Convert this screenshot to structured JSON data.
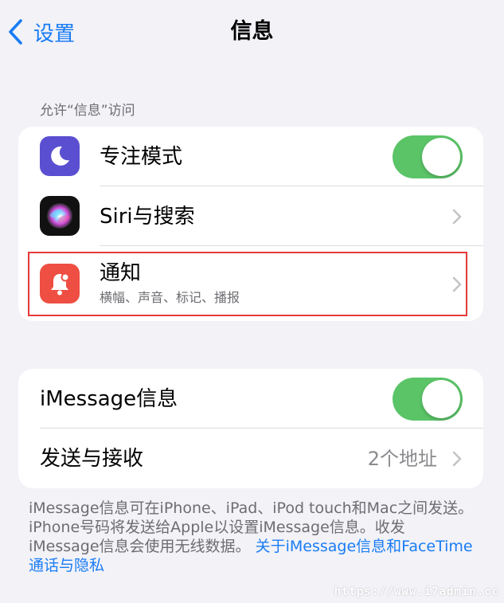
{
  "nav": {
    "back_label": "设置",
    "title": "信息"
  },
  "section": {
    "header": "允许“信息”访问"
  },
  "rows": {
    "focus": {
      "label": "专注模式",
      "icon": "moon-icon",
      "icon_color": "#5b4fd1",
      "toggle_on": true
    },
    "siri": {
      "label": "Siri与搜索",
      "icon": "siri-icon"
    },
    "notifications": {
      "label": "通知",
      "subtitle": "横幅、声音、标记、播报",
      "icon": "bell-icon",
      "icon_color": "#ef4e42"
    },
    "imessage": {
      "label": "iMessage信息",
      "toggle_on": true
    },
    "send_receive": {
      "label": "发送与接收",
      "value": "2个地址"
    }
  },
  "footer": {
    "text": "iMessage信息可在iPhone、iPad、iPod touch和Mac之间发送。iPhone号码将发送给Apple以设置iMessage信息。收发 iMessage信息会使用无线数据。",
    "link": "关于iMessage信息和FaceTime通话与隐私"
  },
  "watermark": "https://www.i7admin.cc",
  "colors": {
    "accent": "#1a7cf5",
    "toggle_on": "#5ac467",
    "highlight": "#e43a3a"
  }
}
